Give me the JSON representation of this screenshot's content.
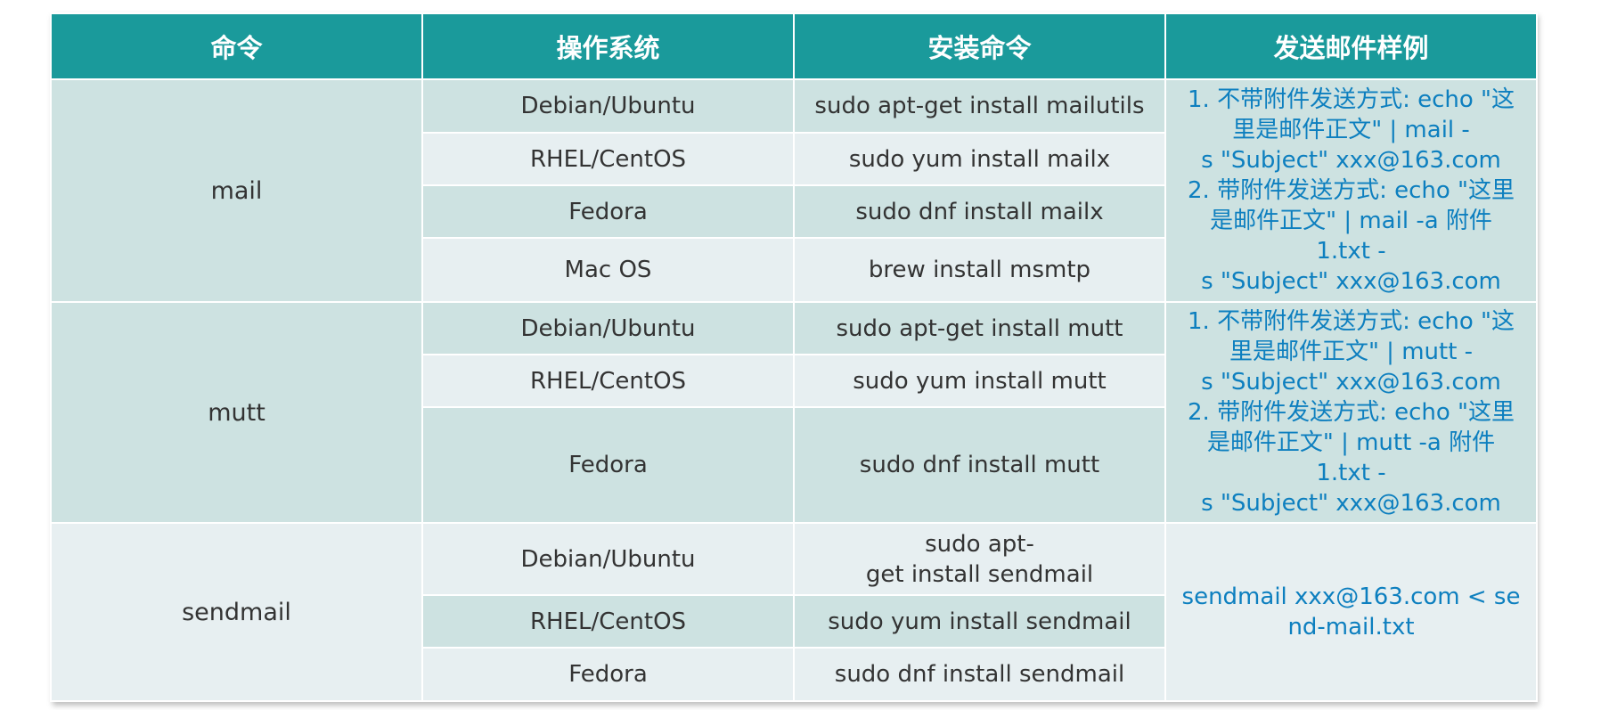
{
  "headers": [
    "命令",
    "操作系统",
    "安装命令",
    "发送邮件样例"
  ],
  "groups": [
    {
      "command": "mail",
      "rows": [
        {
          "os": "Debian/Ubuntu",
          "install": "sudo apt-get install mailutils"
        },
        {
          "os": "RHEL/CentOS",
          "install": "sudo yum install mailx"
        },
        {
          "os": "Fedora",
          "install": "sudo dnf install mailx"
        },
        {
          "os": "Mac OS",
          "install": "brew install msmtp"
        }
      ],
      "example": [
        "1. 不带附件发送方式: echo \"这",
        "里是邮件正文\" | mail -",
        "s \"Subject\" xxx@163.com",
        "2. 带附件发送方式: echo \"这里",
        "是邮件正文\" | mail -a 附件",
        "1.txt -",
        "s \"Subject\" xxx@163.com"
      ]
    },
    {
      "command": "mutt",
      "rows": [
        {
          "os": "Debian/Ubuntu",
          "install": "sudo apt-get install mutt"
        },
        {
          "os": "RHEL/CentOS",
          "install": "sudo yum install mutt"
        },
        {
          "os": "Fedora",
          "install": "sudo dnf install mutt"
        }
      ],
      "example": [
        "1. 不带附件发送方式: echo \"这",
        "里是邮件正文\" | mutt -",
        "s \"Subject\" xxx@163.com",
        "2. 带附件发送方式: echo \"这里",
        "是邮件正文\" | mutt -a 附件",
        "1.txt -",
        "s \"Subject\" xxx@163.com"
      ]
    },
    {
      "command": "sendmail",
      "rows": [
        {
          "os": "Debian/Ubuntu",
          "install_lines": [
            "sudo apt-",
            "get install sendmail"
          ]
        },
        {
          "os": "RHEL/CentOS",
          "install": "sudo yum install sendmail"
        },
        {
          "os": "Fedora",
          "install": "sudo dnf install sendmail"
        }
      ],
      "example": [
        "sendmail xxx@163.com < se",
        "nd-mail.txt"
      ]
    }
  ]
}
